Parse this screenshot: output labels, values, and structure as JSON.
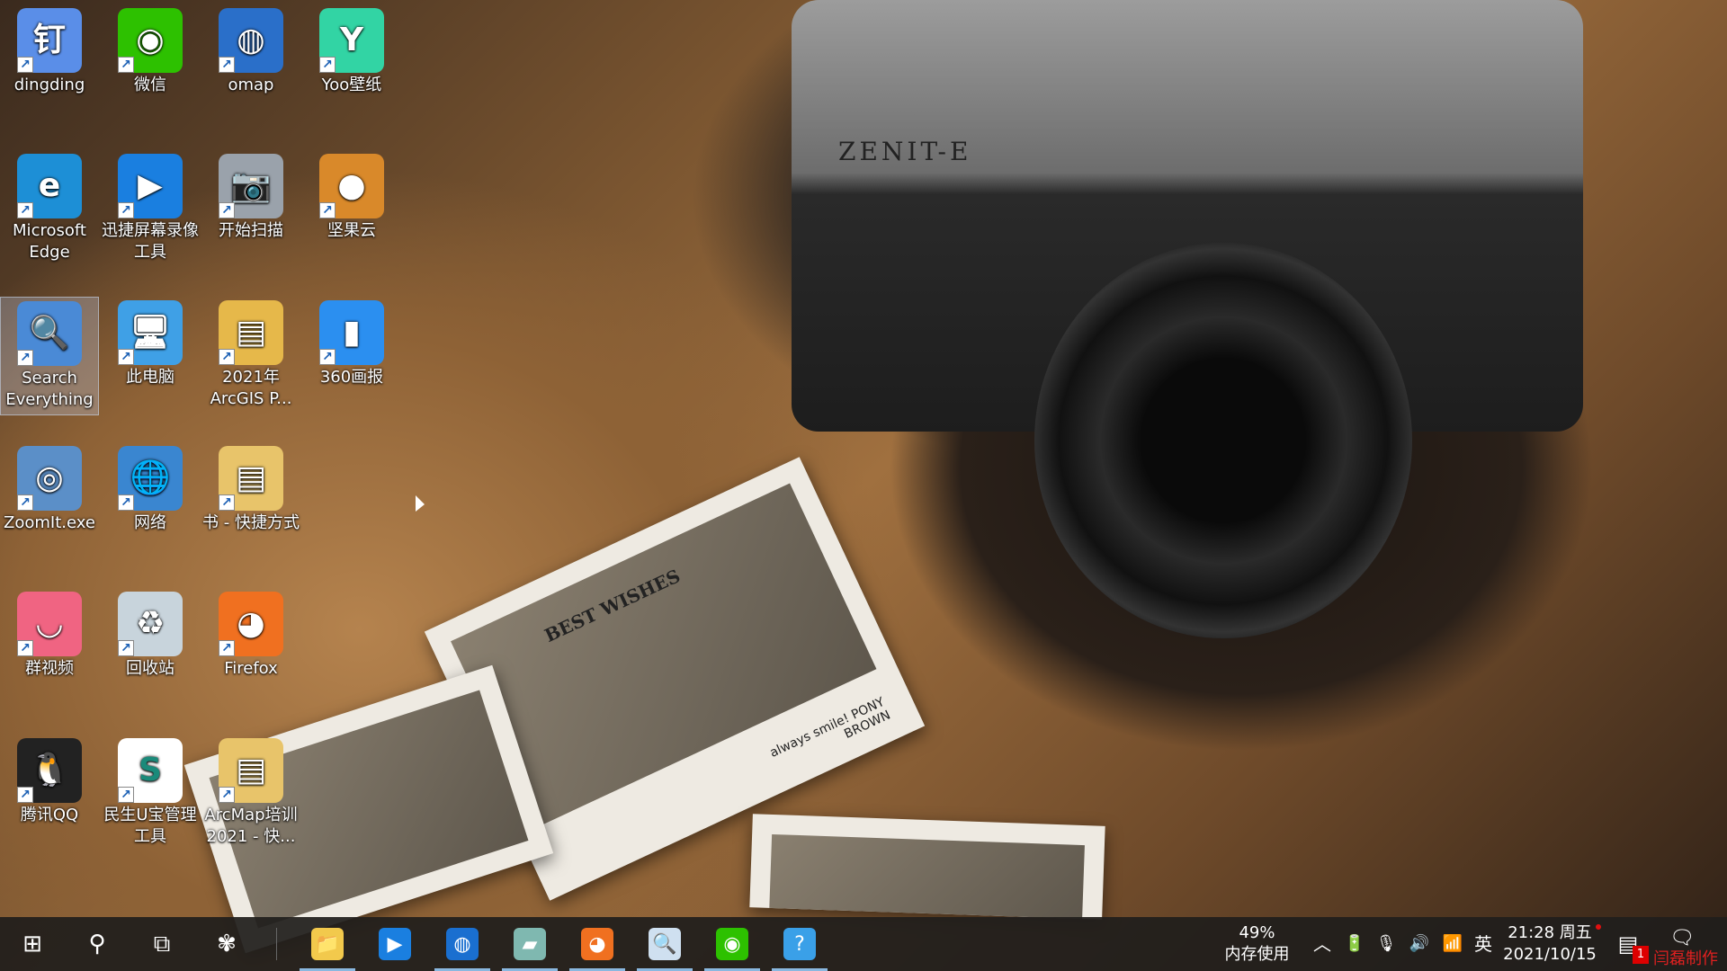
{
  "desktop": {
    "icons": [
      {
        "label": "dingding",
        "col": 0,
        "row": 0,
        "color": "#5a8ee8",
        "glyph": "钉"
      },
      {
        "label": "微信",
        "col": 1,
        "row": 0,
        "color": "#2dc100",
        "glyph": "◉"
      },
      {
        "label": "omap",
        "col": 2,
        "row": 0,
        "color": "#2a6fc9",
        "glyph": "◍"
      },
      {
        "label": "Yoo壁纸",
        "col": 3,
        "row": 0,
        "color": "#32d4a4",
        "glyph": "Y"
      },
      {
        "label": "Microsoft Edge",
        "col": 0,
        "row": 1,
        "color": "#1d8fd6",
        "glyph": "e"
      },
      {
        "label": "迅捷屏幕录像工具",
        "col": 1,
        "row": 1,
        "color": "#1a7fe0",
        "glyph": "▶"
      },
      {
        "label": "开始扫描",
        "col": 2,
        "row": 1,
        "color": "#9aa2ab",
        "glyph": "📷"
      },
      {
        "label": "坚果云",
        "col": 3,
        "row": 1,
        "color": "#d9892a",
        "glyph": "●"
      },
      {
        "label": "Search Everything",
        "col": 0,
        "row": 2,
        "color": "#4a8ad6",
        "glyph": "🔍",
        "selected": true
      },
      {
        "label": "此电脑",
        "col": 1,
        "row": 2,
        "color": "#3fa0e6",
        "glyph": "🖥"
      },
      {
        "label": "2021年ArcGIS P...",
        "col": 2,
        "row": 2,
        "color": "#e6b84a",
        "glyph": "▤"
      },
      {
        "label": "360画报",
        "col": 3,
        "row": 2,
        "color": "#2b8ff0",
        "glyph": "▮"
      },
      {
        "label": "ZoomIt.exe",
        "col": 0,
        "row": 3,
        "color": "#5b8fc8",
        "glyph": "◎"
      },
      {
        "label": "网络",
        "col": 1,
        "row": 3,
        "color": "#3a86d0",
        "glyph": "🌐"
      },
      {
        "label": "书 - 快捷方式",
        "col": 2,
        "row": 3,
        "color": "#e8c46a",
        "glyph": "▤"
      },
      {
        "label": "群视频",
        "col": 0,
        "row": 4,
        "color": "#f06482",
        "glyph": "◡"
      },
      {
        "label": "回收站",
        "col": 1,
        "row": 4,
        "color": "#c8d4dc",
        "glyph": "♻"
      },
      {
        "label": "Firefox",
        "col": 2,
        "row": 4,
        "color": "#f07020",
        "glyph": "◕"
      },
      {
        "label": "腾讯QQ",
        "col": 0,
        "row": 5,
        "color": "#222222",
        "glyph": "🐧"
      },
      {
        "label": "民生U宝管理工具",
        "col": 1,
        "row": 5,
        "color": "#ffffff",
        "glyph": "S"
      },
      {
        "label": "ArcMap培训2021 - 快...",
        "col": 2,
        "row": 5,
        "color": "#e8c46a",
        "glyph": "▤"
      }
    ]
  },
  "wallpaper": {
    "camera_brand": "ZENIT-E",
    "photo_caption": "always smile! PONY BROWN",
    "photo_title": "BEST WISHES"
  },
  "taskbar": {
    "left": [
      {
        "name": "start-button",
        "glyph": "⊞"
      },
      {
        "name": "search-button",
        "glyph": "⚲"
      },
      {
        "name": "task-view-button",
        "glyph": "⧉"
      },
      {
        "name": "app-launcher-button",
        "glyph": "✾"
      }
    ],
    "pinned": [
      {
        "name": "file-explorer",
        "glyph": "📁",
        "active": true,
        "color": "#f2c94c"
      },
      {
        "name": "screen-recorder",
        "glyph": "▶",
        "active": false,
        "color": "#1a7fe0"
      },
      {
        "name": "omap",
        "glyph": "◍",
        "active": true,
        "color": "#1a6fd0"
      },
      {
        "name": "notepad",
        "glyph": "▰",
        "active": true,
        "color": "#7fb8b0"
      },
      {
        "name": "firefox",
        "glyph": "◕",
        "active": true,
        "color": "#f07020"
      },
      {
        "name": "search-everything",
        "glyph": "🔍",
        "active": true,
        "color": "#cfe0f0"
      },
      {
        "name": "wechat",
        "glyph": "◉",
        "active": true,
        "color": "#2dc100"
      },
      {
        "name": "help",
        "glyph": "?",
        "active": true,
        "color": "#3aa0e8"
      }
    ],
    "memory": {
      "percent": "49%",
      "label": "内存使用"
    },
    "ime": "英",
    "clock": {
      "time": "21:28 周五",
      "date": "2021/10/15"
    },
    "notification_count": "1",
    "watermark": "闫磊制作"
  }
}
